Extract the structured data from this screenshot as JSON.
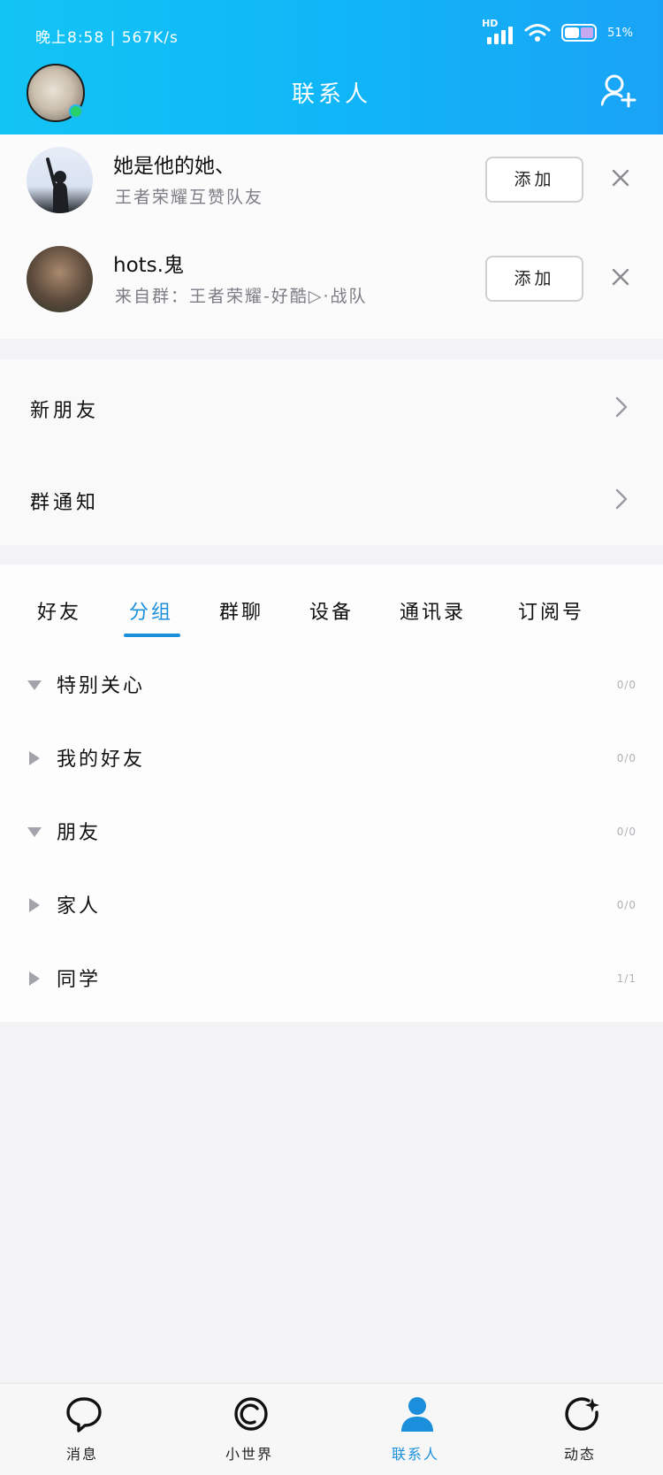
{
  "status_bar": {
    "time_speed": "晚上8:58 | 567K/s",
    "hd_label": "HD",
    "battery_text": "51%"
  },
  "header": {
    "title": "联系人",
    "avatar_icon": "avatar-image",
    "add_icon": "add-contact-icon"
  },
  "recommendations": [
    {
      "name": "她是他的她、",
      "desc": "王者荣耀互赞队友",
      "button": "添加"
    },
    {
      "name": "hots.鬼",
      "desc": "来自群：王者荣耀-好酷▷·战队",
      "button": "添加"
    }
  ],
  "menu": {
    "new_friends": "新朋友",
    "group_notice": "群通知"
  },
  "tabs": {
    "items": [
      "好友",
      "分组",
      "群聊",
      "设备",
      "通讯录",
      "订阅号"
    ],
    "active_index": 1
  },
  "groups": [
    {
      "name": "特别关心",
      "count": "0/0",
      "expanded": true
    },
    {
      "name": "我的好友",
      "count": "0/0",
      "expanded": false
    },
    {
      "name": "朋友",
      "count": "0/0",
      "expanded": true
    },
    {
      "name": "家人",
      "count": "0/0",
      "expanded": false
    },
    {
      "name": "同学",
      "count": "1/1",
      "expanded": false
    }
  ],
  "bottom_nav": {
    "items": [
      "消息",
      "小世界",
      "联系人",
      "动态"
    ],
    "active_index": 2
  },
  "colors": {
    "accent": "#1a8fdc",
    "header_start": "#12c4f4",
    "header_end": "#1aa3f6",
    "online": "#28d06a"
  }
}
